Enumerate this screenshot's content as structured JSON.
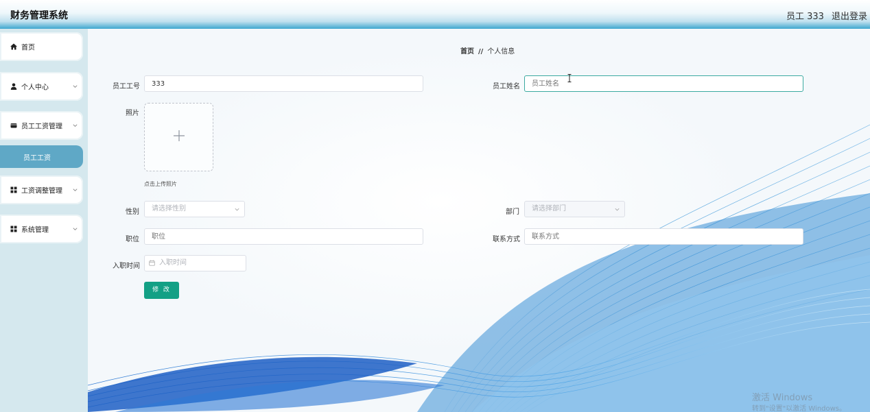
{
  "app": {
    "title": "财务管理系统"
  },
  "header": {
    "user_label": "员工 333",
    "logout_label": "退出登录"
  },
  "sidebar": {
    "items": [
      {
        "label": "首页",
        "icon": "home-icon"
      },
      {
        "label": "个人中心",
        "icon": "person-icon"
      },
      {
        "label": "员工工资管理",
        "icon": "wallet-icon"
      },
      {
        "label": "工资调整管理",
        "icon": "grid-icon"
      },
      {
        "label": "系统管理",
        "icon": "grid-icon"
      }
    ],
    "active_submenu": {
      "label": "员工工资"
    },
    "colors": {
      "background": "#d5e8ee",
      "active": "#5fa8c6"
    }
  },
  "breadcrumb": {
    "home": "首页",
    "separator": "//",
    "current": "个人信息"
  },
  "form": {
    "employee_no": {
      "label": "员工工号",
      "value": "333"
    },
    "employee_name": {
      "label": "员工姓名",
      "placeholder": "员工姓名"
    },
    "photo": {
      "label": "照片",
      "tip": "点击上传照片"
    },
    "gender": {
      "label": "性别",
      "placeholder": "请选择性别"
    },
    "department": {
      "label": "部门",
      "placeholder": "请选择部门"
    },
    "position": {
      "label": "职位",
      "placeholder": "职位"
    },
    "contact": {
      "label": "联系方式",
      "placeholder": "联系方式"
    },
    "hire_date": {
      "label": "入职时间",
      "placeholder": "入职时间"
    },
    "submit_label": "修 改"
  },
  "watermark": {
    "line1": "激活 Windows",
    "line2": "转到\"设置\"以激活 Windows。"
  },
  "colors": {
    "accent": "#13a085",
    "focus_border": "#3aa9a0",
    "header_blue": "#3ea7cf"
  }
}
